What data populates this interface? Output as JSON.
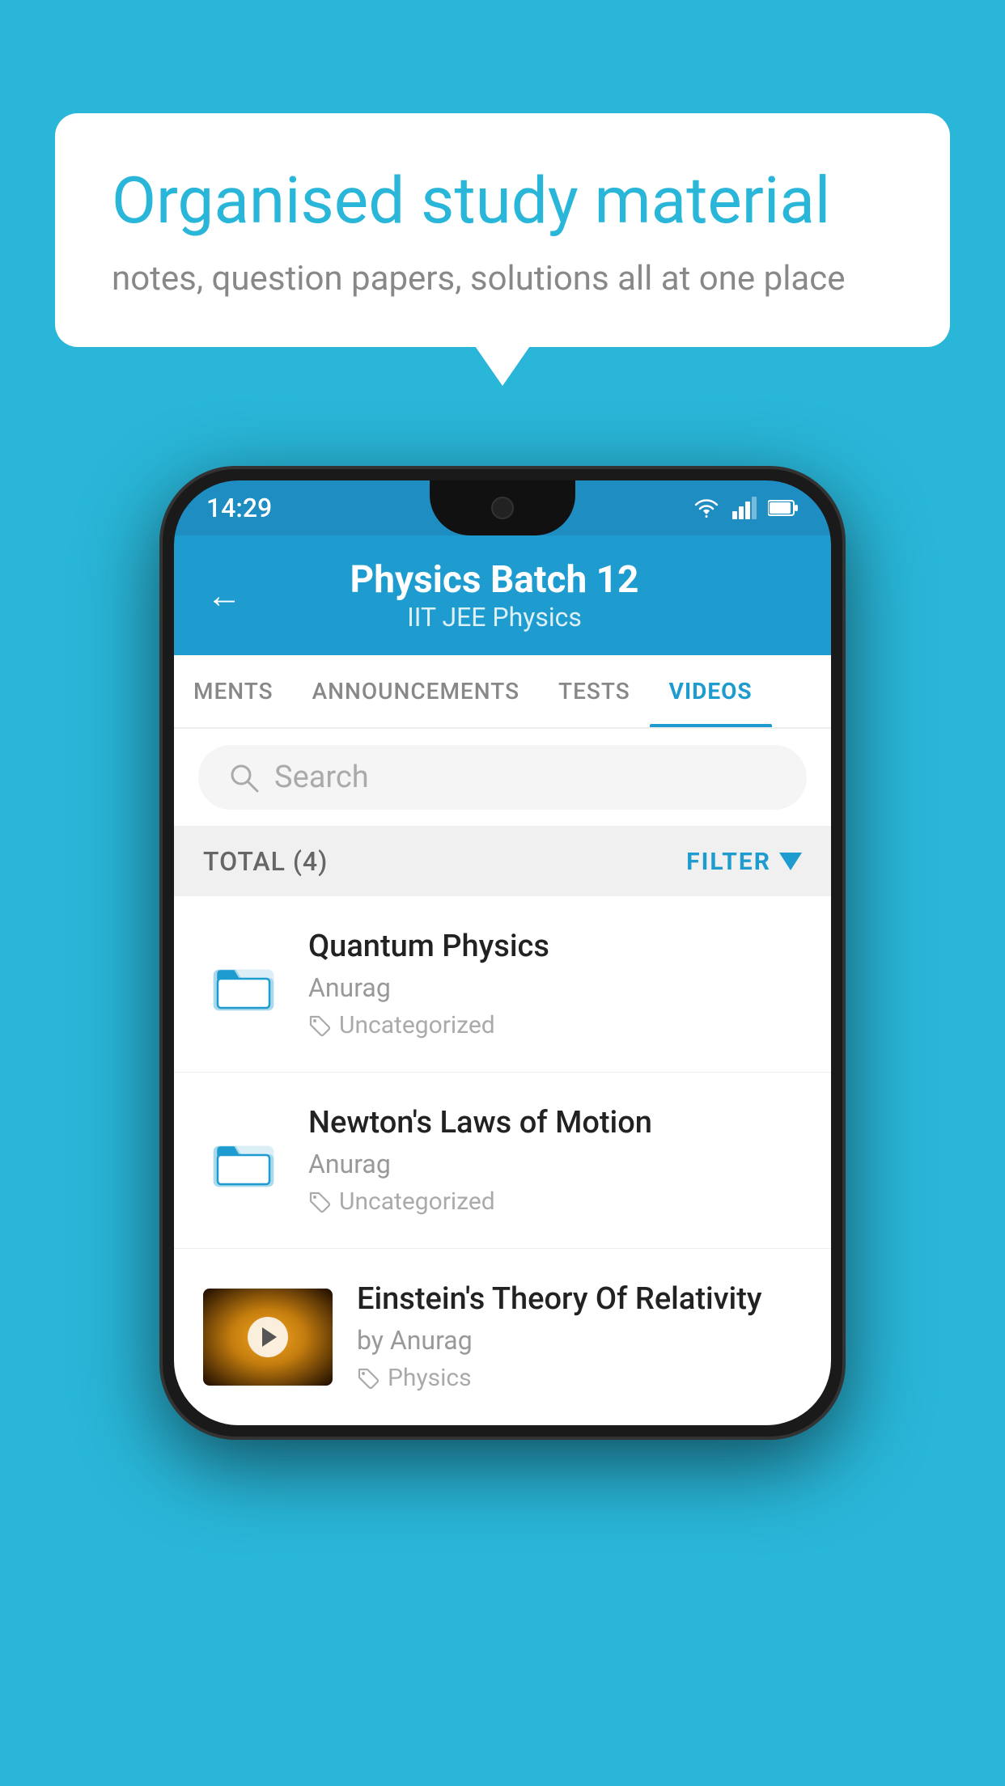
{
  "background": {
    "color": "#29b6d8"
  },
  "speech_bubble": {
    "title": "Organised study material",
    "subtitle": "notes, question papers, solutions all at one place"
  },
  "phone": {
    "status_bar": {
      "time": "14:29"
    },
    "header": {
      "back_label": "←",
      "title": "Physics Batch 12",
      "subtitle": "IIT JEE   Physics"
    },
    "tabs": [
      {
        "label": "MENTS",
        "active": false
      },
      {
        "label": "ANNOUNCEMENTS",
        "active": false
      },
      {
        "label": "TESTS",
        "active": false
      },
      {
        "label": "VIDEOS",
        "active": true
      }
    ],
    "search": {
      "placeholder": "Search"
    },
    "filter_bar": {
      "total_label": "TOTAL (4)",
      "filter_label": "FILTER"
    },
    "videos": [
      {
        "id": 1,
        "title": "Quantum Physics",
        "author": "Anurag",
        "tag": "Uncategorized",
        "has_thumbnail": false
      },
      {
        "id": 2,
        "title": "Newton's Laws of Motion",
        "author": "Anurag",
        "tag": "Uncategorized",
        "has_thumbnail": false
      },
      {
        "id": 3,
        "title": "Einstein's Theory Of Relativity",
        "author": "by Anurag",
        "tag": "Physics",
        "has_thumbnail": true
      }
    ]
  }
}
